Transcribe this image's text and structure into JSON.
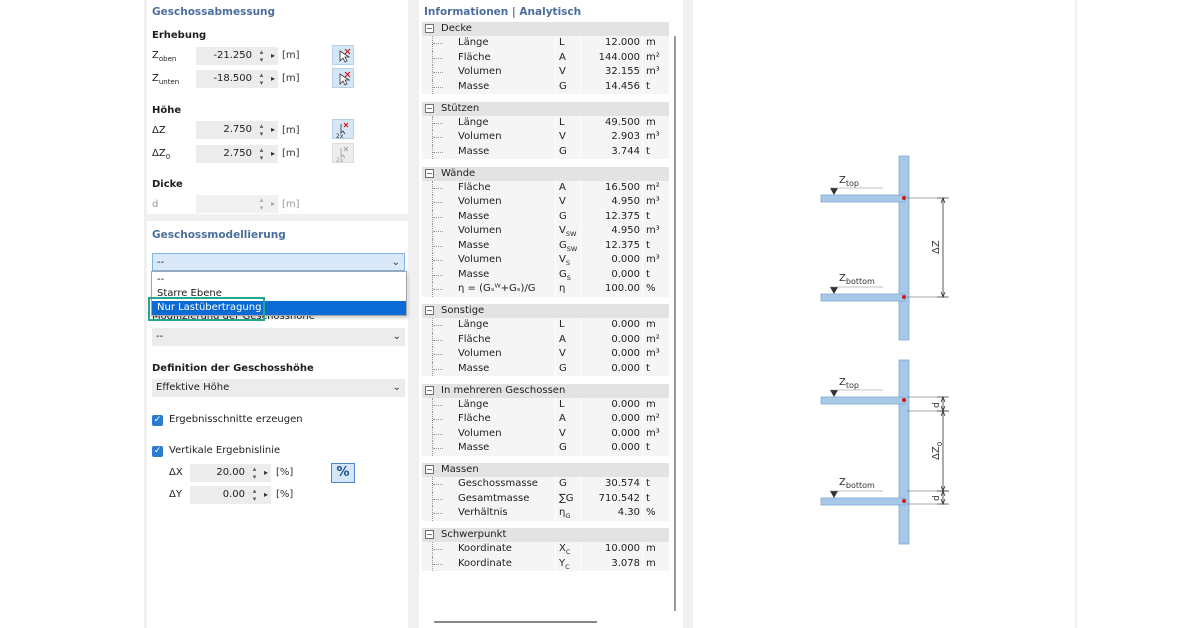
{
  "left": {
    "geschossabmessung": {
      "title": "Geschossabmessung",
      "erhebung": "Erhebung",
      "z_oben_label": "Z",
      "z_oben_sub": "oben",
      "z_oben_value": "-21.250",
      "z_unten_label": "Z",
      "z_unten_sub": "unten",
      "z_unten_value": "-18.500",
      "unit": "[m]",
      "hoehe": "Höhe",
      "dz_label": "ΔZ",
      "dz_value": "2.750",
      "dz0_label": "ΔZ",
      "dz0_sub": "0",
      "dz0_value": "2.750",
      "dicke": "Dicke",
      "d_label": "d"
    },
    "geschossmodellierung": {
      "title": "Geschossmodellierung",
      "select_value": "--",
      "dropdown_options": [
        "--",
        "Starre Ebene",
        "Nur Lastübertragung"
      ],
      "selected_option": "Nur Lastübertragung",
      "hidden_label": "Modifizierung der Geschosshöhe",
      "second_select_value": "--",
      "definition_label": "Definition der Geschosshöhe",
      "definition_value": "Effektive Höhe",
      "cb1_label": "Ergebnisschnitte erzeugen",
      "cb2_label": "Vertikale Ergebnislinie",
      "dx_label": "ΔX",
      "dx_value": "20.00",
      "dy_label": "ΔY",
      "dy_value": "0.00",
      "pct_unit": "[%]",
      "pct_button": "%"
    }
  },
  "info": {
    "title": "Informationen | Analytisch",
    "sections": [
      {
        "name": "Decke",
        "rows": [
          {
            "label": "Länge",
            "sym": "L",
            "sub": "",
            "value": "12.000",
            "unit": "m"
          },
          {
            "label": "Fläche",
            "sym": "A",
            "sub": "",
            "value": "144.000",
            "unit": "m²"
          },
          {
            "label": "Volumen",
            "sym": "V",
            "sub": "",
            "value": "32.155",
            "unit": "m³"
          },
          {
            "label": "Masse",
            "sym": "G",
            "sub": "",
            "value": "14.456",
            "unit": "t"
          }
        ]
      },
      {
        "name": "Stützen",
        "rows": [
          {
            "label": "Länge",
            "sym": "L",
            "sub": "",
            "value": "49.500",
            "unit": "m"
          },
          {
            "label": "Volumen",
            "sym": "V",
            "sub": "",
            "value": "2.903",
            "unit": "m³"
          },
          {
            "label": "Masse",
            "sym": "G",
            "sub": "",
            "value": "3.744",
            "unit": "t"
          }
        ]
      },
      {
        "name": "Wände",
        "rows": [
          {
            "label": "Fläche",
            "sym": "A",
            "sub": "",
            "value": "16.500",
            "unit": "m²"
          },
          {
            "label": "Volumen",
            "sym": "V",
            "sub": "",
            "value": "4.950",
            "unit": "m³"
          },
          {
            "label": "Masse",
            "sym": "G",
            "sub": "",
            "value": "12.375",
            "unit": "t"
          },
          {
            "label": "Volumen",
            "sym": "V",
            "sub": "SW",
            "value": "4.950",
            "unit": "m³"
          },
          {
            "label": "Masse",
            "sym": "G",
            "sub": "SW",
            "value": "12.375",
            "unit": "t"
          },
          {
            "label": "Volumen",
            "sym": "V",
            "sub": "S",
            "value": "0.000",
            "unit": "m³"
          },
          {
            "label": "Masse",
            "sym": "G",
            "sub": "S",
            "value": "0.000",
            "unit": "t"
          },
          {
            "label": "η = (Gₛᵂ+Gₛ)/G",
            "sym": "η",
            "sub": "",
            "value": "100.00",
            "unit": "%"
          }
        ]
      },
      {
        "name": "Sonstige",
        "rows": [
          {
            "label": "Länge",
            "sym": "L",
            "sub": "",
            "value": "0.000",
            "unit": "m"
          },
          {
            "label": "Fläche",
            "sym": "A",
            "sub": "",
            "value": "0.000",
            "unit": "m²"
          },
          {
            "label": "Volumen",
            "sym": "V",
            "sub": "",
            "value": "0.000",
            "unit": "m³"
          },
          {
            "label": "Masse",
            "sym": "G",
            "sub": "",
            "value": "0.000",
            "unit": "t"
          }
        ]
      },
      {
        "name": "In mehreren Geschossen",
        "rows": [
          {
            "label": "Länge",
            "sym": "L",
            "sub": "",
            "value": "0.000",
            "unit": "m"
          },
          {
            "label": "Fläche",
            "sym": "A",
            "sub": "",
            "value": "0.000",
            "unit": "m²"
          },
          {
            "label": "Volumen",
            "sym": "V",
            "sub": "",
            "value": "0.000",
            "unit": "m³"
          },
          {
            "label": "Masse",
            "sym": "G",
            "sub": "",
            "value": "0.000",
            "unit": "t"
          }
        ]
      },
      {
        "name": "Massen",
        "rows": [
          {
            "label": "Geschossmasse",
            "sym": "G",
            "sub": "",
            "value": "30.574",
            "unit": "t"
          },
          {
            "label": "Gesamtmasse",
            "sym": "∑G",
            "sub": "",
            "value": "710.542",
            "unit": "t"
          },
          {
            "label": "Verhältnis",
            "sym": "η",
            "sub": "G",
            "value": "4.30",
            "unit": "%"
          }
        ]
      },
      {
        "name": "Schwerpunkt",
        "rows": [
          {
            "label": "Koordinate",
            "sym": "X",
            "sub": "C",
            "value": "10.000",
            "unit": "m"
          },
          {
            "label": "Koordinate",
            "sym": "Y",
            "sub": "C",
            "value": "3.078",
            "unit": "m"
          }
        ]
      }
    ]
  },
  "diagram": {
    "top": {
      "z_top": "Z",
      "z_top_sub": "top",
      "z_bottom": "Z",
      "z_bottom_sub": "bottom",
      "dim": "ΔZ"
    },
    "bottom": {
      "z_top": "Z",
      "z_top_sub": "top",
      "z_bottom": "Z",
      "z_bottom_sub": "bottom",
      "dim": "ΔZ",
      "dim_sub": "0",
      "d": "d"
    },
    "colors": {
      "slab": "#a8c8e8",
      "slab_edge": "#7ea9d3",
      "node": "#d11a1a",
      "dim": "#333333"
    }
  }
}
